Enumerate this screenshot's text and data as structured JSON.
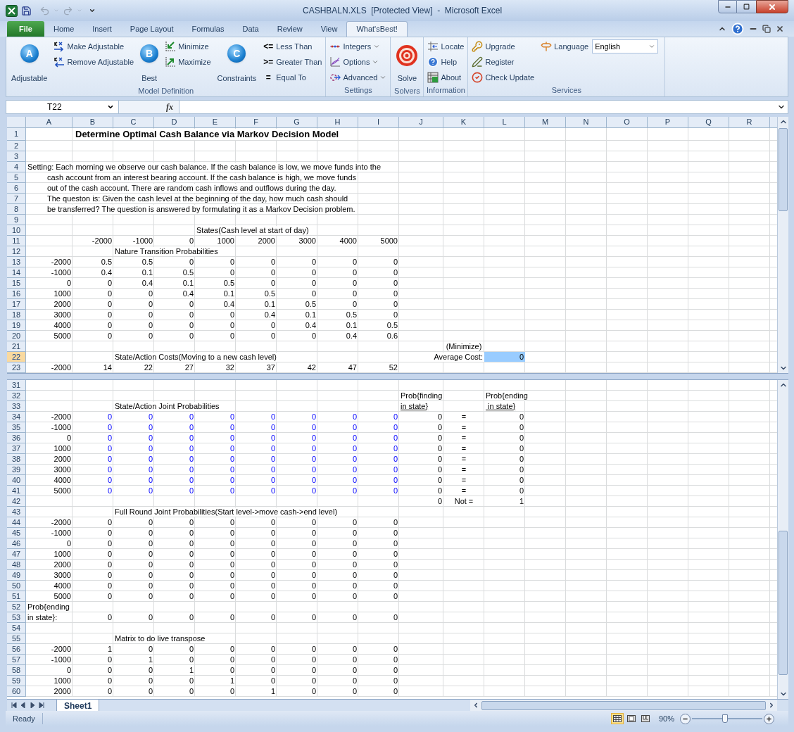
{
  "window": {
    "title": "CASHBALN.XLS  [Protected View]  -  Microsoft Excel"
  },
  "ribbon_tabs": [
    {
      "label": "File",
      "kind": "file",
      "selected": false
    },
    {
      "label": "Home",
      "kind": "tab",
      "selected": false
    },
    {
      "label": "Insert",
      "kind": "tab",
      "selected": false
    },
    {
      "label": "Page Layout",
      "kind": "tab",
      "selected": false
    },
    {
      "label": "Formulas",
      "kind": "tab",
      "selected": false
    },
    {
      "label": "Data",
      "kind": "tab",
      "selected": false
    },
    {
      "label": "Review",
      "kind": "tab",
      "selected": false
    },
    {
      "label": "View",
      "kind": "tab",
      "selected": false
    },
    {
      "label": "What'sBest!",
      "kind": "tab",
      "selected": true
    }
  ],
  "ribbon": {
    "groups": [
      {
        "label": "Model Definition",
        "columns": [
          {
            "kind": "large",
            "items": [
              {
                "label": "Adjustable",
                "badge": "A"
              }
            ]
          },
          {
            "kind": "stack",
            "items": [
              {
                "label": "Make Adjustable"
              },
              {
                "label": "Remove Adjustable"
              }
            ]
          },
          {
            "kind": "large",
            "items": [
              {
                "label": "Best",
                "badge": "B"
              }
            ]
          },
          {
            "kind": "stack",
            "items": [
              {
                "label": "Minimize"
              },
              {
                "label": "Maximize"
              }
            ]
          },
          {
            "kind": "large",
            "items": [
              {
                "label": "Constraints",
                "badge": "C"
              }
            ]
          },
          {
            "kind": "stack",
            "items": [
              {
                "label": "Less Than",
                "symbol": "<="
              },
              {
                "label": "Greater Than",
                "symbol": ">="
              },
              {
                "label": "Equal To",
                "symbol": "="
              }
            ]
          }
        ]
      },
      {
        "label": "Settings",
        "columns": [
          {
            "kind": "stack",
            "items": [
              {
                "label": "Integers",
                "dropdown": true
              },
              {
                "label": "Options",
                "dropdown": true
              },
              {
                "label": "Advanced",
                "dropdown": true
              }
            ]
          }
        ]
      },
      {
        "label": "Solvers",
        "columns": [
          {
            "kind": "large",
            "items": [
              {
                "label": "Solve"
              }
            ]
          }
        ]
      },
      {
        "label": "Information",
        "columns": [
          {
            "kind": "stack",
            "items": [
              {
                "label": "Locate"
              },
              {
                "label": "Help"
              },
              {
                "label": "About"
              }
            ]
          }
        ]
      },
      {
        "label": "Services",
        "columns": [
          {
            "kind": "stack",
            "items": [
              {
                "label": "Upgrade"
              },
              {
                "label": "Register"
              },
              {
                "label": "Check Update"
              }
            ]
          },
          {
            "kind": "select",
            "items": [
              {
                "label": "Language",
                "value": "English"
              }
            ]
          }
        ]
      }
    ]
  },
  "formula_bar": {
    "name_box": "T22",
    "function_label": "fx"
  },
  "columns": [
    "A",
    "B",
    "C",
    "D",
    "E",
    "F",
    "G",
    "H",
    "I",
    "J",
    "K",
    "L",
    "M",
    "N",
    "O",
    "P",
    "Q",
    "R"
  ],
  "top_pane": {
    "rows": [
      {
        "label": "1",
        "selected": false,
        "cells": {
          "b": {
            "text": "Determine Optimal Cash Balance via Markov Decision Model",
            "kind": "title"
          }
        }
      },
      {
        "label": "2",
        "selected": false
      },
      {
        "label": "3",
        "selected": false
      },
      {
        "label": "4",
        "selected": false,
        "cells": {
          "a": {
            "text": "Setting: Each morning we observe our cash balance.  If the cash balance is low, we move funds into the",
            "kind": "text"
          }
        }
      },
      {
        "label": "5",
        "selected": false,
        "cells": {
          "a": {
            "text": "cash account from an interest bearing account.  If the cash balance is high, we move funds",
            "kind": "indent"
          }
        }
      },
      {
        "label": "6",
        "selected": false,
        "cells": {
          "a": {
            "text": "out of the cash account.  There are random cash inflows and outflows during the day.",
            "kind": "indent"
          }
        }
      },
      {
        "label": "7",
        "selected": false,
        "cells": {
          "a": {
            "text": "The queston is:  Given the cash level at the beginning of the day,  how much cash should",
            "kind": "indent"
          }
        }
      },
      {
        "label": "8",
        "selected": false,
        "cells": {
          "a": {
            "text": "be transferred?   The question is answered by formulating it as a Markov Decision problem.",
            "kind": "indent"
          }
        }
      },
      {
        "label": "9",
        "selected": false
      },
      {
        "label": "10",
        "selected": false,
        "cells": {
          "e": {
            "text": "States(Cash level at start of day)",
            "kind": "text"
          }
        }
      },
      {
        "label": "11",
        "selected": false,
        "cells": {
          "b": "-2000",
          "c": "-1000",
          "d": "0",
          "e": "1000",
          "f": "2000",
          "g": "3000",
          "h": "4000",
          "i": "5000"
        }
      },
      {
        "label": "12",
        "selected": false,
        "cells": {
          "c": {
            "text": "Nature Transition Probabilities",
            "kind": "text"
          }
        }
      },
      {
        "label": "13",
        "selected": false,
        "cells": {
          "a": "-2000",
          "b": "0.5",
          "c": "0.5",
          "d": "0",
          "e": "0",
          "f": "0",
          "g": "0",
          "h": "0",
          "i": "0"
        }
      },
      {
        "label": "14",
        "selected": false,
        "cells": {
          "a": "-1000",
          "b": "0.4",
          "c": "0.1",
          "d": "0.5",
          "e": "0",
          "f": "0",
          "g": "0",
          "h": "0",
          "i": "0"
        }
      },
      {
        "label": "15",
        "selected": false,
        "cells": {
          "a": "0",
          "b": "0",
          "c": "0.4",
          "d": "0.1",
          "e": "0.5",
          "f": "0",
          "g": "0",
          "h": "0",
          "i": "0"
        }
      },
      {
        "label": "16",
        "selected": false,
        "cells": {
          "a": "1000",
          "b": "0",
          "c": "0",
          "d": "0.4",
          "e": "0.1",
          "f": "0.5",
          "g": "0",
          "h": "0",
          "i": "0"
        }
      },
      {
        "label": "17",
        "selected": false,
        "cells": {
          "a": "2000",
          "b": "0",
          "c": "0",
          "d": "0",
          "e": "0.4",
          "f": "0.1",
          "g": "0.5",
          "h": "0",
          "i": "0"
        }
      },
      {
        "label": "18",
        "selected": false,
        "cells": {
          "a": "3000",
          "b": "0",
          "c": "0",
          "d": "0",
          "e": "0",
          "f": "0.4",
          "g": "0.1",
          "h": "0.5",
          "i": "0"
        }
      },
      {
        "label": "19",
        "selected": false,
        "cells": {
          "a": "4000",
          "b": "0",
          "c": "0",
          "d": "0",
          "e": "0",
          "f": "0",
          "g": "0.4",
          "h": "0.1",
          "i": "0.5"
        }
      },
      {
        "label": "20",
        "selected": false,
        "cells": {
          "a": "5000",
          "b": "0",
          "c": "0",
          "d": "0",
          "e": "0",
          "f": "0",
          "g": "0",
          "h": "0.4",
          "i": "0.6"
        }
      },
      {
        "label": "21",
        "selected": false,
        "cells": {
          "k": {
            "text": "(Minimize)",
            "kind": "center"
          }
        }
      },
      {
        "label": "22",
        "selected": true,
        "cells": {
          "c": {
            "text": "State/Action Costs(Moving to a new cash level)",
            "kind": "text"
          },
          "k": {
            "text": "Average Cost:",
            "kind": "right"
          },
          "l": {
            "text": "0",
            "kind": "objective"
          }
        }
      },
      {
        "label": "23",
        "selected": false,
        "cells": {
          "a": "-2000",
          "b": "14",
          "c": "22",
          "d": "27",
          "e": "32",
          "f": "37",
          "g": "42",
          "h": "47",
          "i": "52"
        }
      }
    ]
  },
  "bottom_pane": {
    "rows": [
      {
        "label": "31",
        "selected": false
      },
      {
        "label": "32",
        "selected": false,
        "cells": {
          "j": {
            "text": "Prob{finding",
            "kind": "text"
          },
          "l": {
            "text": "Prob{ending",
            "kind": "text"
          }
        }
      },
      {
        "label": "33",
        "selected": false,
        "cells": {
          "c": {
            "text": "State/Action Joint Probabilities",
            "kind": "text"
          },
          "j": {
            "text": "in state}",
            "kind": "underlined"
          },
          "l": {
            "text": " in state}",
            "kind": "underlined"
          }
        }
      },
      {
        "label": "34",
        "selected": false,
        "cells": {
          "a": "-2000",
          "b": {
            "text": "0",
            "kind": "input"
          },
          "c": {
            "text": "0",
            "kind": "input"
          },
          "d": {
            "text": "0",
            "kind": "input"
          },
          "e": {
            "text": "0",
            "kind": "input"
          },
          "f": {
            "text": "0",
            "kind": "input"
          },
          "g": {
            "text": "0",
            "kind": "input"
          },
          "h": {
            "text": "0",
            "kind": "input"
          },
          "i": {
            "text": "0",
            "kind": "input"
          },
          "j": "0",
          "k": {
            "text": "=",
            "kind": "center"
          },
          "l": "0"
        }
      },
      {
        "label": "35",
        "selected": false,
        "cells": {
          "a": "-1000",
          "b": {
            "text": "0",
            "kind": "input"
          },
          "c": {
            "text": "0",
            "kind": "input"
          },
          "d": {
            "text": "0",
            "kind": "input"
          },
          "e": {
            "text": "0",
            "kind": "input"
          },
          "f": {
            "text": "0",
            "kind": "input"
          },
          "g": {
            "text": "0",
            "kind": "input"
          },
          "h": {
            "text": "0",
            "kind": "input"
          },
          "i": {
            "text": "0",
            "kind": "input"
          },
          "j": "0",
          "k": {
            "text": "=",
            "kind": "center"
          },
          "l": "0"
        }
      },
      {
        "label": "36",
        "selected": false,
        "cells": {
          "a": "0",
          "b": {
            "text": "0",
            "kind": "input"
          },
          "c": {
            "text": "0",
            "kind": "input"
          },
          "d": {
            "text": "0",
            "kind": "input"
          },
          "e": {
            "text": "0",
            "kind": "input"
          },
          "f": {
            "text": "0",
            "kind": "input"
          },
          "g": {
            "text": "0",
            "kind": "input"
          },
          "h": {
            "text": "0",
            "kind": "input"
          },
          "i": {
            "text": "0",
            "kind": "input"
          },
          "j": "0",
          "k": {
            "text": "=",
            "kind": "center"
          },
          "l": "0"
        }
      },
      {
        "label": "37",
        "selected": false,
        "cells": {
          "a": "1000",
          "b": {
            "text": "0",
            "kind": "input"
          },
          "c": {
            "text": "0",
            "kind": "input"
          },
          "d": {
            "text": "0",
            "kind": "input"
          },
          "e": {
            "text": "0",
            "kind": "input"
          },
          "f": {
            "text": "0",
            "kind": "input"
          },
          "g": {
            "text": "0",
            "kind": "input"
          },
          "h": {
            "text": "0",
            "kind": "input"
          },
          "i": {
            "text": "0",
            "kind": "input"
          },
          "j": "0",
          "k": {
            "text": "=",
            "kind": "center"
          },
          "l": "0"
        }
      },
      {
        "label": "38",
        "selected": false,
        "cells": {
          "a": "2000",
          "b": {
            "text": "0",
            "kind": "input"
          },
          "c": {
            "text": "0",
            "kind": "input"
          },
          "d": {
            "text": "0",
            "kind": "input"
          },
          "e": {
            "text": "0",
            "kind": "input"
          },
          "f": {
            "text": "0",
            "kind": "input"
          },
          "g": {
            "text": "0",
            "kind": "input"
          },
          "h": {
            "text": "0",
            "kind": "input"
          },
          "i": {
            "text": "0",
            "kind": "input"
          },
          "j": "0",
          "k": {
            "text": "=",
            "kind": "center"
          },
          "l": "0"
        }
      },
      {
        "label": "39",
        "selected": false,
        "cells": {
          "a": "3000",
          "b": {
            "text": "0",
            "kind": "input"
          },
          "c": {
            "text": "0",
            "kind": "input"
          },
          "d": {
            "text": "0",
            "kind": "input"
          },
          "e": {
            "text": "0",
            "kind": "input"
          },
          "f": {
            "text": "0",
            "kind": "input"
          },
          "g": {
            "text": "0",
            "kind": "input"
          },
          "h": {
            "text": "0",
            "kind": "input"
          },
          "i": {
            "text": "0",
            "kind": "input"
          },
          "j": "0",
          "k": {
            "text": "=",
            "kind": "center"
          },
          "l": "0"
        }
      },
      {
        "label": "40",
        "selected": false,
        "cells": {
          "a": "4000",
          "b": {
            "text": "0",
            "kind": "input"
          },
          "c": {
            "text": "0",
            "kind": "input"
          },
          "d": {
            "text": "0",
            "kind": "input"
          },
          "e": {
            "text": "0",
            "kind": "input"
          },
          "f": {
            "text": "0",
            "kind": "input"
          },
          "g": {
            "text": "0",
            "kind": "input"
          },
          "h": {
            "text": "0",
            "kind": "input"
          },
          "i": {
            "text": "0",
            "kind": "input"
          },
          "j": "0",
          "k": {
            "text": "=",
            "kind": "center"
          },
          "l": "0"
        }
      },
      {
        "label": "41",
        "selected": false,
        "cells": {
          "a": "5000",
          "b": {
            "text": "0",
            "kind": "input"
          },
          "c": {
            "text": "0",
            "kind": "input"
          },
          "d": {
            "text": "0",
            "kind": "input"
          },
          "e": {
            "text": "0",
            "kind": "input"
          },
          "f": {
            "text": "0",
            "kind": "input"
          },
          "g": {
            "text": "0",
            "kind": "input"
          },
          "h": {
            "text": "0",
            "kind": "input"
          },
          "i": {
            "text": "0",
            "kind": "input"
          },
          "j": "0",
          "k": {
            "text": "=",
            "kind": "center"
          },
          "l": "0"
        }
      },
      {
        "label": "42",
        "selected": false,
        "cells": {
          "j": "0",
          "k": {
            "text": "Not =",
            "kind": "center"
          },
          "l": "1"
        }
      },
      {
        "label": "43",
        "selected": false,
        "cells": {
          "c": {
            "text": "Full Round Joint Probabilities(Start level->move cash->end level)",
            "kind": "text"
          }
        }
      },
      {
        "label": "44",
        "selected": false,
        "cells": {
          "a": "-2000",
          "b": "0",
          "c": "0",
          "d": "0",
          "e": "0",
          "f": "0",
          "g": "0",
          "h": "0",
          "i": "0"
        }
      },
      {
        "label": "45",
        "selected": false,
        "cells": {
          "a": "-1000",
          "b": "0",
          "c": "0",
          "d": "0",
          "e": "0",
          "f": "0",
          "g": "0",
          "h": "0",
          "i": "0"
        }
      },
      {
        "label": "46",
        "selected": false,
        "cells": {
          "a": "0",
          "b": "0",
          "c": "0",
          "d": "0",
          "e": "0",
          "f": "0",
          "g": "0",
          "h": "0",
          "i": "0"
        }
      },
      {
        "label": "47",
        "selected": false,
        "cells": {
          "a": "1000",
          "b": "0",
          "c": "0",
          "d": "0",
          "e": "0",
          "f": "0",
          "g": "0",
          "h": "0",
          "i": "0"
        }
      },
      {
        "label": "48",
        "selected": false,
        "cells": {
          "a": "2000",
          "b": "0",
          "c": "0",
          "d": "0",
          "e": "0",
          "f": "0",
          "g": "0",
          "h": "0",
          "i": "0"
        }
      },
      {
        "label": "49",
        "selected": false,
        "cells": {
          "a": "3000",
          "b": "0",
          "c": "0",
          "d": "0",
          "e": "0",
          "f": "0",
          "g": "0",
          "h": "0",
          "i": "0"
        }
      },
      {
        "label": "50",
        "selected": false,
        "cells": {
          "a": "4000",
          "b": "0",
          "c": "0",
          "d": "0",
          "e": "0",
          "f": "0",
          "g": "0",
          "h": "0",
          "i": "0"
        }
      },
      {
        "label": "51",
        "selected": false,
        "cells": {
          "a": "5000",
          "b": "0",
          "c": "0",
          "d": "0",
          "e": "0",
          "f": "0",
          "g": "0",
          "h": "0",
          "i": "0"
        }
      },
      {
        "label": "52",
        "selected": false,
        "cells": {
          "a": {
            "text": "Prob{ending",
            "kind": "text"
          }
        }
      },
      {
        "label": "53",
        "selected": false,
        "cells": {
          "a": {
            "text": "in state}:",
            "kind": "text"
          },
          "b": "0",
          "c": "0",
          "d": "0",
          "e": "0",
          "f": "0",
          "g": "0",
          "h": "0",
          "i": "0"
        }
      },
      {
        "label": "54",
        "selected": false
      },
      {
        "label": "55",
        "selected": false,
        "cells": {
          "c": {
            "text": "Matrix to do live transpose",
            "kind": "text"
          }
        }
      },
      {
        "label": "56",
        "selected": false,
        "cells": {
          "a": "-2000",
          "b": "1",
          "c": "0",
          "d": "0",
          "e": "0",
          "f": "0",
          "g": "0",
          "h": "0",
          "i": "0"
        }
      },
      {
        "label": "57",
        "selected": false,
        "cells": {
          "a": "-1000",
          "b": "0",
          "c": "1",
          "d": "0",
          "e": "0",
          "f": "0",
          "g": "0",
          "h": "0",
          "i": "0"
        }
      },
      {
        "label": "58",
        "selected": false,
        "cells": {
          "a": "0",
          "b": "0",
          "c": "0",
          "d": "1",
          "e": "0",
          "f": "0",
          "g": "0",
          "h": "0",
          "i": "0"
        }
      },
      {
        "label": "59",
        "selected": false,
        "cells": {
          "a": "1000",
          "b": "0",
          "c": "0",
          "d": "0",
          "e": "1",
          "f": "0",
          "g": "0",
          "h": "0",
          "i": "0"
        }
      },
      {
        "label": "60",
        "selected": false,
        "cells": {
          "a": "2000",
          "b": "0",
          "c": "0",
          "d": "0",
          "e": "0",
          "f": "1",
          "g": "0",
          "h": "0",
          "i": "0"
        }
      }
    ]
  },
  "sheet_tabs": [
    {
      "label": "Sheet1",
      "selected": true
    }
  ],
  "status_bar": {
    "status": "Ready",
    "views": [
      {
        "kind": "normal",
        "selected": true
      },
      {
        "kind": "page-layout",
        "selected": false
      },
      {
        "kind": "page-break",
        "selected": false
      }
    ],
    "zoom": "90%",
    "zoom_slider": {
      "level": 0.47
    }
  }
}
